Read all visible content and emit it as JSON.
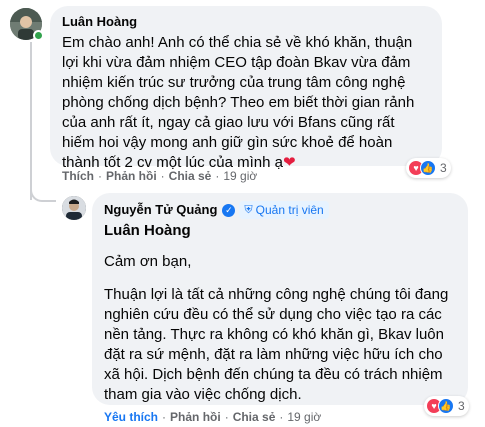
{
  "comment": {
    "author": "Luân Hoàng",
    "text": "Em chào anh! Anh có thể chia sẻ về khó khăn, thuận lợi khi vừa đảm nhiệm CEO tập đoàn Bkav vừa đảm nhiệm kiến trúc sư trưởng của trung tâm công nghệ phòng chống dịch bệnh? Theo em biết thời gian rảnh của anh rất ít, ngay cả giao lưu với Bfans cũng rất hiếm hoi vậy mong anh giữ gìn sức khoẻ để hoàn thành tốt 2 cv một lúc của mình ạ",
    "heart": "❤",
    "reaction_count": "3",
    "actions": {
      "like": "Thích",
      "reply": "Phản hồi",
      "share": "Chia sẻ",
      "time": "19 giờ"
    }
  },
  "reply": {
    "author": "Nguyễn Tử Quảng",
    "badge": "Quản trị viên",
    "mention": "Luân Hoàng",
    "paragraph1": "Cảm ơn bạn,",
    "paragraph2": "Thuận lợi là tất cả những công nghệ chúng tôi đang nghiên cứu đều có thể sử dụng cho việc tạo ra các nền tảng. Thực ra không có khó khăn gì, Bkav luôn đặt ra sứ mệnh, đặt ra làm những việc hữu ích cho xã hội. Dịch bệnh đến chúng ta đều có trách nhiệm tham gia vào việc chống dịch.",
    "reaction_count": "3",
    "actions": {
      "like": "Yêu thích",
      "reply": "Phản hồi",
      "share": "Chia sẻ",
      "time": "19 giờ"
    }
  },
  "separator": "·",
  "icons": {
    "verified": "✓",
    "shield": "⛨",
    "love": "♥",
    "like": "👍"
  },
  "colors": {
    "bubble": "#f0f2f5",
    "link_blue": "#1877f2",
    "meta_gray": "#65676b",
    "online_green": "#31a24c",
    "heart_red": "#e41e3f"
  }
}
